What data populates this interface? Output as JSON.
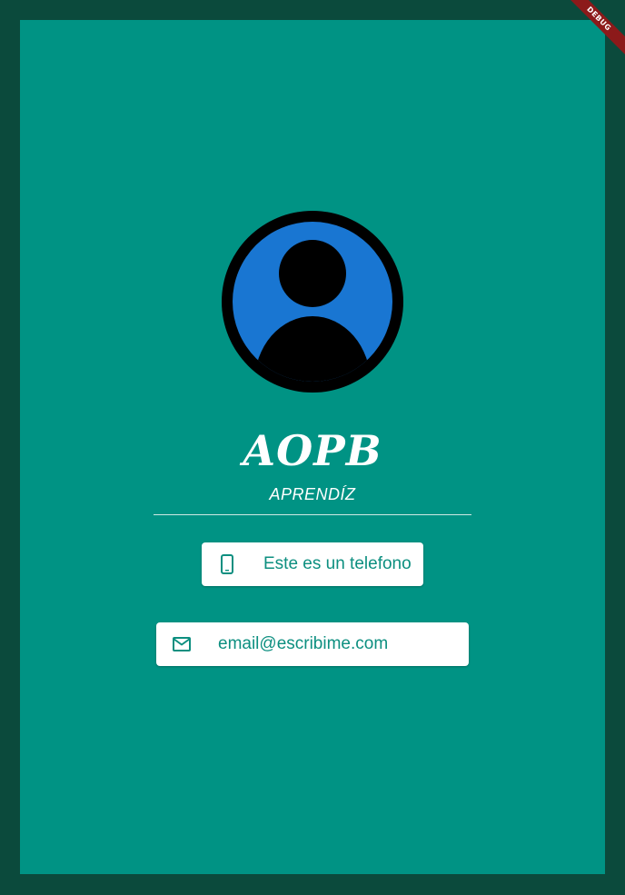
{
  "app": {
    "debug_banner": "DEBUG"
  },
  "profile": {
    "avatar_icon": "account-circle-icon",
    "name": "AOPB",
    "role": "APRENDÍZ"
  },
  "contacts": {
    "phone": {
      "icon": "phone-android-icon",
      "text": "Este es un telefono"
    },
    "email": {
      "icon": "mail-icon",
      "text": "email@escribime.com"
    }
  },
  "colors": {
    "outer_background": "#0b4a3c",
    "background": "#009384",
    "avatar_fill": "#1976d2",
    "card_text": "#0d8f80",
    "debug_ribbon": "#8c1a1a"
  }
}
